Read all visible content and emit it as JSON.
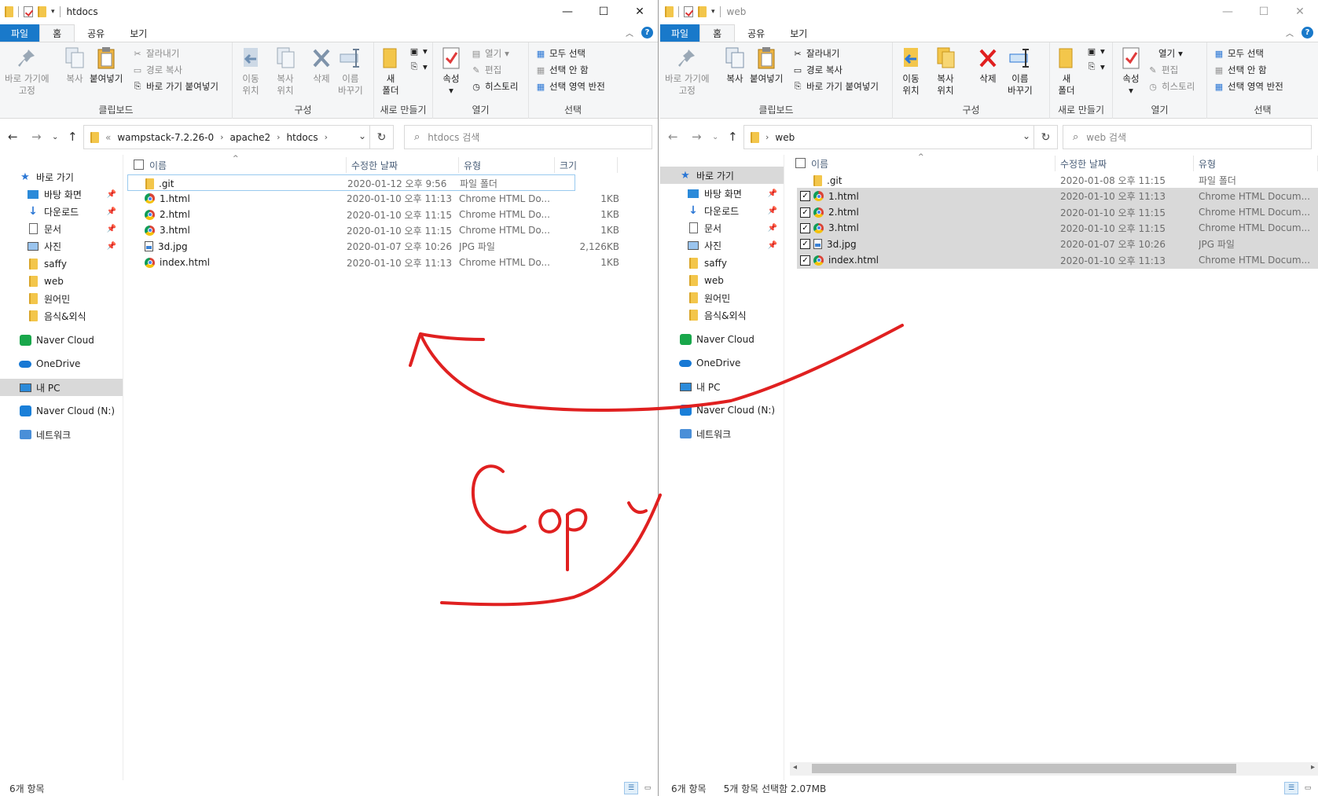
{
  "left": {
    "title": "htdocs",
    "tabs": [
      "파일",
      "홈",
      "공유",
      "보기"
    ],
    "ribbon": {
      "pin_label_1": "바로 가기에",
      "pin_label_2": "고정",
      "copy": "복사",
      "paste": "붙여넣기",
      "cut": "잘라내기",
      "copy_path": "경로 복사",
      "paste_shortcut": "바로 가기 붙여넣기",
      "clipboard_group": "클립보드",
      "move_to_1": "이동",
      "move_to_2": "위치",
      "copy_to_1": "복사",
      "copy_to_2": "위치",
      "delete": "삭제",
      "rename_1": "이름",
      "rename_2": "바꾸기",
      "organize_group": "구성",
      "new_folder_1": "새",
      "new_folder_2": "폴더",
      "new_group": "새로 만들기",
      "properties": "속성",
      "open": "열기",
      "edit": "편집",
      "history": "히스토리",
      "open_group": "열기",
      "select_all": "모두 선택",
      "select_none": "선택 안 함",
      "invert_selection": "선택 영역 반전",
      "select_group": "선택"
    },
    "breadcrumb": [
      "«",
      "wampstack-7.2.26-0",
      "apache2",
      "htdocs"
    ],
    "search_placeholder": "htdocs 검색",
    "columns": {
      "name": "이름",
      "date": "수정한 날짜",
      "type": "유형",
      "size": "크기"
    },
    "nav": {
      "quick_access": "바로 가기",
      "desktop": "바탕 화면",
      "downloads": "다운로드",
      "documents": "문서",
      "pictures": "사진",
      "saffy": "saffy",
      "web": "web",
      "wonomin": "원어민",
      "food": "음식&외식",
      "naver_cloud": "Naver Cloud",
      "onedrive": "OneDrive",
      "this_pc": "내 PC",
      "naver_cloud_n": "Naver Cloud (N:)",
      "network": "네트워크"
    },
    "files": [
      {
        "name": ".git",
        "date": "2020-01-12 오후 9:56",
        "type": "파일 폴더",
        "size": "",
        "icon": "folder-icon"
      },
      {
        "name": "1.html",
        "date": "2020-01-10 오후 11:13",
        "type": "Chrome HTML Do...",
        "size": "1KB",
        "icon": "chrome-icon"
      },
      {
        "name": "2.html",
        "date": "2020-01-10 오후 11:15",
        "type": "Chrome HTML Do...",
        "size": "1KB",
        "icon": "chrome-icon"
      },
      {
        "name": "3.html",
        "date": "2020-01-10 오후 11:15",
        "type": "Chrome HTML Do...",
        "size": "1KB",
        "icon": "chrome-icon"
      },
      {
        "name": "3d.jpg",
        "date": "2020-01-07 오후 10:26",
        "type": "JPG 파일",
        "size": "2,126KB",
        "icon": "jpg-icon"
      },
      {
        "name": "index.html",
        "date": "2020-01-10 오후 11:13",
        "type": "Chrome HTML Do...",
        "size": "1KB",
        "icon": "chrome-icon"
      }
    ],
    "status": "6개 항목"
  },
  "right": {
    "title": "web",
    "breadcrumb": [
      "web"
    ],
    "search_placeholder": "web 검색",
    "columns": {
      "name": "이름",
      "date": "수정한 날짜",
      "type": "유형"
    },
    "nav": {
      "this_pc": "내 PC"
    },
    "files": [
      {
        "name": ".git",
        "date": "2020-01-08 오후 11:15",
        "type": "파일 폴더",
        "selected": false,
        "icon": "folder-icon"
      },
      {
        "name": "1.html",
        "date": "2020-01-10 오후 11:13",
        "type": "Chrome HTML Docum...",
        "selected": true,
        "icon": "chrome-icon"
      },
      {
        "name": "2.html",
        "date": "2020-01-10 오후 11:15",
        "type": "Chrome HTML Docum...",
        "selected": true,
        "icon": "chrome-icon"
      },
      {
        "name": "3.html",
        "date": "2020-01-10 오후 11:15",
        "type": "Chrome HTML Docum...",
        "selected": true,
        "icon": "chrome-icon"
      },
      {
        "name": "3d.jpg",
        "date": "2020-01-07 오후 10:26",
        "type": "JPG 파일",
        "selected": true,
        "icon": "jpg-icon"
      },
      {
        "name": "index.html",
        "date": "2020-01-10 오후 11:13",
        "type": "Chrome HTML Docum...",
        "selected": true,
        "icon": "chrome-icon"
      }
    ],
    "status_count": "6개 항목",
    "status_selected": "5개 항목 선택함 2.07MB"
  },
  "annotation": {
    "text": "Copy",
    "color": "#e02020"
  },
  "colors": {
    "accent": "#1979ca",
    "selection": "#d9d9d9"
  }
}
